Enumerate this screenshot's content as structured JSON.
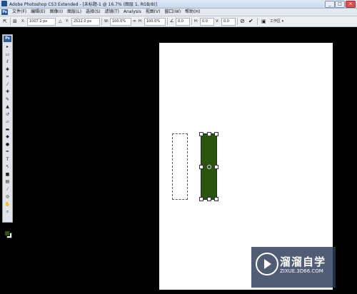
{
  "window": {
    "title": "Adobe Photoshop CS3 Extended - [未标题-1 @ 16.7% (图层 1, RGB/8)]",
    "minimize": "_",
    "maximize": "□",
    "close": "×"
  },
  "menubar": {
    "logo": "Ps",
    "items": [
      "文件(F)",
      "编辑(E)",
      "图像(I)",
      "图层(L)",
      "选择(S)",
      "滤镜(T)",
      "Analysis",
      "视图(V)",
      "窗口(W)",
      "帮助(H)"
    ]
  },
  "options": {
    "x_label": "X:",
    "x_value": "1007.2 px",
    "y_label": "Y:",
    "y_value": "2522.0 px",
    "w_label": "W:",
    "w_value": "100.0%",
    "h_label": "H:",
    "h_value": "100.0%",
    "angle_value": "0.0",
    "hskew_label": "H:",
    "hskew_value": "0.0",
    "vskew_label": "V:",
    "vskew_value": "0.0",
    "workspace": "工作区 ▾"
  },
  "toolbox": {
    "logo": "Ps",
    "tools": [
      {
        "name": "move-tool-icon",
        "glyph": "▸"
      },
      {
        "name": "marquee-tool-icon",
        "glyph": "▭"
      },
      {
        "name": "lasso-tool-icon",
        "glyph": "ℓ"
      },
      {
        "name": "magic-wand-tool-icon",
        "glyph": "✱"
      },
      {
        "name": "crop-tool-icon",
        "glyph": "⌗"
      },
      {
        "name": "slice-tool-icon",
        "glyph": "⁄"
      },
      {
        "name": "healing-brush-tool-icon",
        "glyph": "✚"
      },
      {
        "name": "brush-tool-icon",
        "glyph": "✎"
      },
      {
        "name": "clone-stamp-tool-icon",
        "glyph": "▲"
      },
      {
        "name": "history-brush-tool-icon",
        "glyph": "↺"
      },
      {
        "name": "eraser-tool-icon",
        "glyph": "▱"
      },
      {
        "name": "gradient-tool-icon",
        "glyph": "▬"
      },
      {
        "name": "blur-tool-icon",
        "glyph": "◆"
      },
      {
        "name": "dodge-tool-icon",
        "glyph": "●"
      },
      {
        "name": "pen-tool-icon",
        "glyph": "✒"
      },
      {
        "name": "type-tool-icon",
        "glyph": "T"
      },
      {
        "name": "path-selection-tool-icon",
        "glyph": "↖"
      },
      {
        "name": "shape-tool-icon",
        "glyph": "■"
      },
      {
        "name": "notes-tool-icon",
        "glyph": "▤"
      },
      {
        "name": "eyedropper-tool-icon",
        "glyph": "⁄"
      },
      {
        "name": "3d-rotate-tool-icon",
        "glyph": "◎"
      },
      {
        "name": "hand-tool-icon",
        "glyph": "✋"
      },
      {
        "name": "zoom-tool-icon",
        "glyph": "⌕"
      }
    ]
  },
  "colors": {
    "foreground": "#2b5410",
    "background": "#ffffff",
    "canvas_background": "#000000"
  },
  "watermark": {
    "brand": "溜溜自学",
    "url": "ZIXUE.3D66.COM"
  }
}
